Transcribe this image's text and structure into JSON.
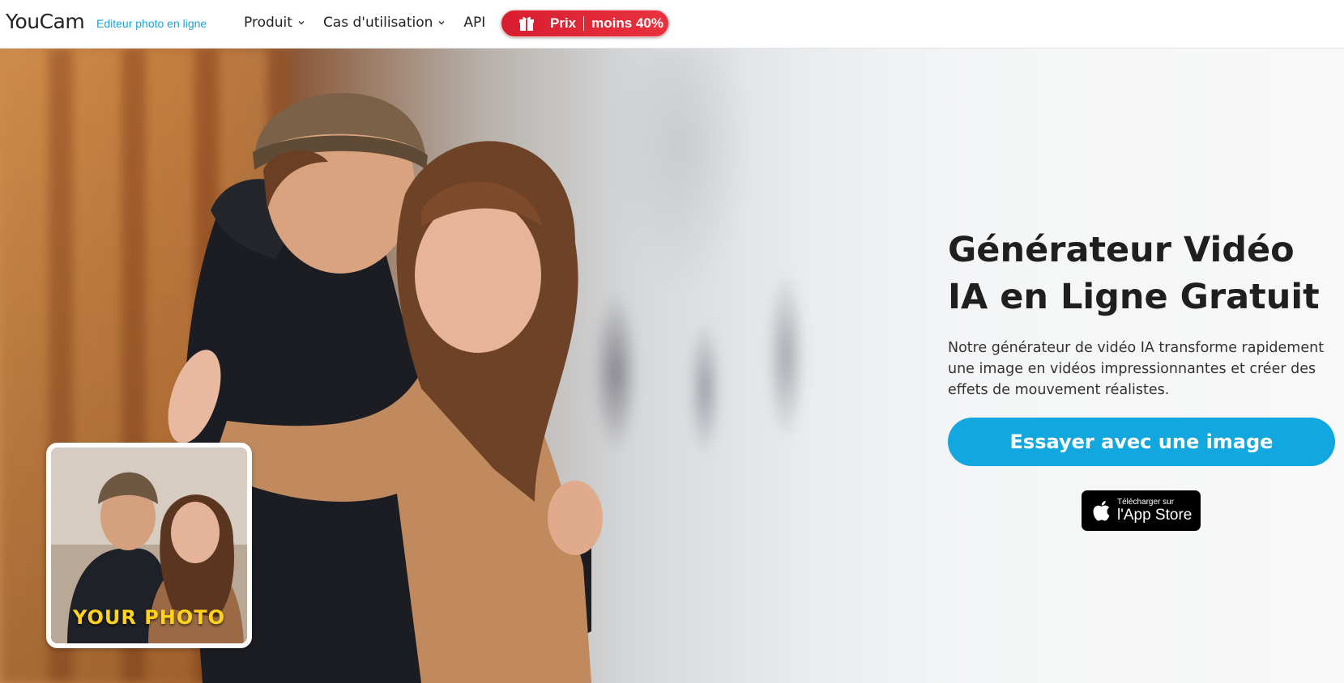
{
  "header": {
    "logo": "YouCam",
    "logo_subtitle": "Editeur photo en ligne",
    "nav": [
      {
        "label": "Produit",
        "has_dropdown": true
      },
      {
        "label": "Cas d'utilisation",
        "has_dropdown": true
      },
      {
        "label": "API",
        "has_dropdown": false
      }
    ],
    "promo": {
      "label": "Prix",
      "discount": "moins 40%",
      "icon": "gift-icon",
      "color": "#e02634"
    }
  },
  "hero": {
    "title": "Générateur Vidéo IA en Ligne Gratuit",
    "description": "Notre générateur de vidéo IA transforme rapidement une image en vidéos impressionnantes et créer des effets de mouvement réalistes.",
    "cta_label": "Essayer avec une image",
    "cta_color": "#12a8df",
    "thumbnail_label": "YOUR PHOTO",
    "app_store": {
      "small": "Télécharger sur",
      "big": "l'App Store",
      "icon": "apple-icon"
    }
  }
}
